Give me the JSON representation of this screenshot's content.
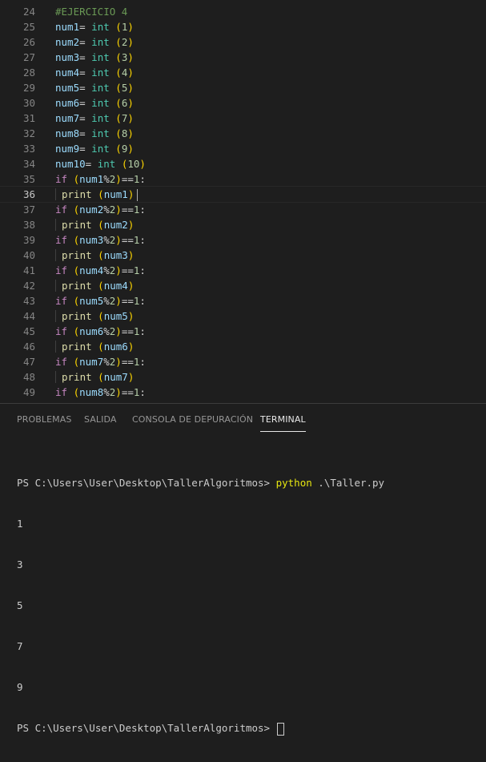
{
  "editor": {
    "current_line": 36,
    "lines": [
      {
        "n": "24",
        "tokens": [
          {
            "t": "#EJERCICIO 4",
            "c": "comment"
          }
        ]
      },
      {
        "n": "25",
        "tokens": [
          {
            "t": "num1",
            "c": "var"
          },
          {
            "t": "= ",
            "c": "plain"
          },
          {
            "t": "int",
            "c": "fn"
          },
          {
            "t": " ",
            "c": "plain"
          },
          {
            "t": "(",
            "c": "paren"
          },
          {
            "t": "1",
            "c": "num"
          },
          {
            "t": ")",
            "c": "paren"
          }
        ]
      },
      {
        "n": "26",
        "tokens": [
          {
            "t": "num2",
            "c": "var"
          },
          {
            "t": "= ",
            "c": "plain"
          },
          {
            "t": "int",
            "c": "fn"
          },
          {
            "t": " ",
            "c": "plain"
          },
          {
            "t": "(",
            "c": "paren"
          },
          {
            "t": "2",
            "c": "num"
          },
          {
            "t": ")",
            "c": "paren"
          }
        ]
      },
      {
        "n": "27",
        "tokens": [
          {
            "t": "num3",
            "c": "var"
          },
          {
            "t": "= ",
            "c": "plain"
          },
          {
            "t": "int",
            "c": "fn"
          },
          {
            "t": " ",
            "c": "plain"
          },
          {
            "t": "(",
            "c": "paren"
          },
          {
            "t": "3",
            "c": "num"
          },
          {
            "t": ")",
            "c": "paren"
          }
        ]
      },
      {
        "n": "28",
        "tokens": [
          {
            "t": "num4",
            "c": "var"
          },
          {
            "t": "= ",
            "c": "plain"
          },
          {
            "t": "int",
            "c": "fn"
          },
          {
            "t": " ",
            "c": "plain"
          },
          {
            "t": "(",
            "c": "paren"
          },
          {
            "t": "4",
            "c": "num"
          },
          {
            "t": ")",
            "c": "paren"
          }
        ]
      },
      {
        "n": "29",
        "tokens": [
          {
            "t": "num5",
            "c": "var"
          },
          {
            "t": "= ",
            "c": "plain"
          },
          {
            "t": "int",
            "c": "fn"
          },
          {
            "t": " ",
            "c": "plain"
          },
          {
            "t": "(",
            "c": "paren"
          },
          {
            "t": "5",
            "c": "num"
          },
          {
            "t": ")",
            "c": "paren"
          }
        ]
      },
      {
        "n": "30",
        "tokens": [
          {
            "t": "num6",
            "c": "var"
          },
          {
            "t": "= ",
            "c": "plain"
          },
          {
            "t": "int",
            "c": "fn"
          },
          {
            "t": " ",
            "c": "plain"
          },
          {
            "t": "(",
            "c": "paren"
          },
          {
            "t": "6",
            "c": "num"
          },
          {
            "t": ")",
            "c": "paren"
          }
        ]
      },
      {
        "n": "31",
        "tokens": [
          {
            "t": "num7",
            "c": "var"
          },
          {
            "t": "= ",
            "c": "plain"
          },
          {
            "t": "int",
            "c": "fn"
          },
          {
            "t": " ",
            "c": "plain"
          },
          {
            "t": "(",
            "c": "paren"
          },
          {
            "t": "7",
            "c": "num"
          },
          {
            "t": ")",
            "c": "paren"
          }
        ]
      },
      {
        "n": "32",
        "tokens": [
          {
            "t": "num8",
            "c": "var"
          },
          {
            "t": "= ",
            "c": "plain"
          },
          {
            "t": "int",
            "c": "fn"
          },
          {
            "t": " ",
            "c": "plain"
          },
          {
            "t": "(",
            "c": "paren"
          },
          {
            "t": "8",
            "c": "num"
          },
          {
            "t": ")",
            "c": "paren"
          }
        ]
      },
      {
        "n": "33",
        "tokens": [
          {
            "t": "num9",
            "c": "var"
          },
          {
            "t": "= ",
            "c": "plain"
          },
          {
            "t": "int",
            "c": "fn"
          },
          {
            "t": " ",
            "c": "plain"
          },
          {
            "t": "(",
            "c": "paren"
          },
          {
            "t": "9",
            "c": "num"
          },
          {
            "t": ")",
            "c": "paren"
          }
        ]
      },
      {
        "n": "34",
        "tokens": [
          {
            "t": "num10",
            "c": "var"
          },
          {
            "t": "= ",
            "c": "plain"
          },
          {
            "t": "int",
            "c": "fn"
          },
          {
            "t": " ",
            "c": "plain"
          },
          {
            "t": "(",
            "c": "paren"
          },
          {
            "t": "10",
            "c": "num"
          },
          {
            "t": ")",
            "c": "paren"
          }
        ]
      },
      {
        "n": "35",
        "tokens": [
          {
            "t": "if",
            "c": "kw"
          },
          {
            "t": " ",
            "c": "plain"
          },
          {
            "t": "(",
            "c": "paren"
          },
          {
            "t": "num1",
            "c": "var"
          },
          {
            "t": "%",
            "c": "plain"
          },
          {
            "t": "2",
            "c": "num"
          },
          {
            "t": ")",
            "c": "paren"
          },
          {
            "t": "==",
            "c": "plain"
          },
          {
            "t": "1",
            "c": "num"
          },
          {
            "t": ":",
            "c": "plain"
          }
        ]
      },
      {
        "n": "36",
        "indent": true,
        "cursor": true,
        "tokens": [
          {
            "t": "print",
            "c": "call"
          },
          {
            "t": " ",
            "c": "plain"
          },
          {
            "t": "(",
            "c": "paren"
          },
          {
            "t": "num1",
            "c": "var"
          },
          {
            "t": ")",
            "c": "paren"
          }
        ]
      },
      {
        "n": "37",
        "tokens": [
          {
            "t": "if",
            "c": "kw"
          },
          {
            "t": " ",
            "c": "plain"
          },
          {
            "t": "(",
            "c": "paren"
          },
          {
            "t": "num2",
            "c": "var"
          },
          {
            "t": "%",
            "c": "plain"
          },
          {
            "t": "2",
            "c": "num"
          },
          {
            "t": ")",
            "c": "paren"
          },
          {
            "t": "==",
            "c": "plain"
          },
          {
            "t": "1",
            "c": "num"
          },
          {
            "t": ":",
            "c": "plain"
          }
        ]
      },
      {
        "n": "38",
        "indent": true,
        "tokens": [
          {
            "t": "print",
            "c": "call"
          },
          {
            "t": " ",
            "c": "plain"
          },
          {
            "t": "(",
            "c": "paren"
          },
          {
            "t": "num2",
            "c": "var"
          },
          {
            "t": ")",
            "c": "paren"
          }
        ]
      },
      {
        "n": "39",
        "tokens": [
          {
            "t": "if",
            "c": "kw"
          },
          {
            "t": " ",
            "c": "plain"
          },
          {
            "t": "(",
            "c": "paren"
          },
          {
            "t": "num3",
            "c": "var"
          },
          {
            "t": "%",
            "c": "plain"
          },
          {
            "t": "2",
            "c": "num"
          },
          {
            "t": ")",
            "c": "paren"
          },
          {
            "t": "==",
            "c": "plain"
          },
          {
            "t": "1",
            "c": "num"
          },
          {
            "t": ":",
            "c": "plain"
          }
        ]
      },
      {
        "n": "40",
        "indent": true,
        "tokens": [
          {
            "t": "print",
            "c": "call"
          },
          {
            "t": " ",
            "c": "plain"
          },
          {
            "t": "(",
            "c": "paren"
          },
          {
            "t": "num3",
            "c": "var"
          },
          {
            "t": ")",
            "c": "paren"
          }
        ]
      },
      {
        "n": "41",
        "tokens": [
          {
            "t": "if",
            "c": "kw"
          },
          {
            "t": " ",
            "c": "plain"
          },
          {
            "t": "(",
            "c": "paren"
          },
          {
            "t": "num4",
            "c": "var"
          },
          {
            "t": "%",
            "c": "plain"
          },
          {
            "t": "2",
            "c": "num"
          },
          {
            "t": ")",
            "c": "paren"
          },
          {
            "t": "==",
            "c": "plain"
          },
          {
            "t": "1",
            "c": "num"
          },
          {
            "t": ":",
            "c": "plain"
          }
        ]
      },
      {
        "n": "42",
        "indent": true,
        "tokens": [
          {
            "t": "print",
            "c": "call"
          },
          {
            "t": " ",
            "c": "plain"
          },
          {
            "t": "(",
            "c": "paren"
          },
          {
            "t": "num4",
            "c": "var"
          },
          {
            "t": ")",
            "c": "paren"
          }
        ]
      },
      {
        "n": "43",
        "tokens": [
          {
            "t": "if",
            "c": "kw"
          },
          {
            "t": " ",
            "c": "plain"
          },
          {
            "t": "(",
            "c": "paren"
          },
          {
            "t": "num5",
            "c": "var"
          },
          {
            "t": "%",
            "c": "plain"
          },
          {
            "t": "2",
            "c": "num"
          },
          {
            "t": ")",
            "c": "paren"
          },
          {
            "t": "==",
            "c": "plain"
          },
          {
            "t": "1",
            "c": "num"
          },
          {
            "t": ":",
            "c": "plain"
          }
        ]
      },
      {
        "n": "44",
        "indent": true,
        "tokens": [
          {
            "t": "print",
            "c": "call"
          },
          {
            "t": " ",
            "c": "plain"
          },
          {
            "t": "(",
            "c": "paren"
          },
          {
            "t": "num5",
            "c": "var"
          },
          {
            "t": ")",
            "c": "paren"
          }
        ]
      },
      {
        "n": "45",
        "tokens": [
          {
            "t": "if",
            "c": "kw"
          },
          {
            "t": " ",
            "c": "plain"
          },
          {
            "t": "(",
            "c": "paren"
          },
          {
            "t": "num6",
            "c": "var"
          },
          {
            "t": "%",
            "c": "plain"
          },
          {
            "t": "2",
            "c": "num"
          },
          {
            "t": ")",
            "c": "paren"
          },
          {
            "t": "==",
            "c": "plain"
          },
          {
            "t": "1",
            "c": "num"
          },
          {
            "t": ":",
            "c": "plain"
          }
        ]
      },
      {
        "n": "46",
        "indent": true,
        "tokens": [
          {
            "t": "print",
            "c": "call"
          },
          {
            "t": " ",
            "c": "plain"
          },
          {
            "t": "(",
            "c": "paren"
          },
          {
            "t": "num6",
            "c": "var"
          },
          {
            "t": ")",
            "c": "paren"
          }
        ]
      },
      {
        "n": "47",
        "tokens": [
          {
            "t": "if",
            "c": "kw"
          },
          {
            "t": " ",
            "c": "plain"
          },
          {
            "t": "(",
            "c": "paren"
          },
          {
            "t": "num7",
            "c": "var"
          },
          {
            "t": "%",
            "c": "plain"
          },
          {
            "t": "2",
            "c": "num"
          },
          {
            "t": ")",
            "c": "paren"
          },
          {
            "t": "==",
            "c": "plain"
          },
          {
            "t": "1",
            "c": "num"
          },
          {
            "t": ":",
            "c": "plain"
          }
        ]
      },
      {
        "n": "48",
        "indent": true,
        "tokens": [
          {
            "t": "print",
            "c": "call"
          },
          {
            "t": " ",
            "c": "plain"
          },
          {
            "t": "(",
            "c": "paren"
          },
          {
            "t": "num7",
            "c": "var"
          },
          {
            "t": ")",
            "c": "paren"
          }
        ]
      },
      {
        "n": "49",
        "tokens": [
          {
            "t": "if",
            "c": "kw"
          },
          {
            "t": " ",
            "c": "plain"
          },
          {
            "t": "(",
            "c": "paren"
          },
          {
            "t": "num8",
            "c": "var"
          },
          {
            "t": "%",
            "c": "plain"
          },
          {
            "t": "2",
            "c": "num"
          },
          {
            "t": ")",
            "c": "paren"
          },
          {
            "t": "==",
            "c": "plain"
          },
          {
            "t": "1",
            "c": "num"
          },
          {
            "t": ":",
            "c": "plain"
          }
        ]
      }
    ]
  },
  "panel": {
    "tabs": [
      {
        "label": "PROBLEMAS",
        "active": false
      },
      {
        "label": "SALIDA",
        "active": false
      },
      {
        "label": "CONSOLA DE DEPURACIÓN",
        "active": false
      },
      {
        "label": "TERMINAL",
        "active": true
      }
    ],
    "terminal": {
      "prompt": "PS C:\\Users\\User\\Desktop\\TallerAlgoritmos> ",
      "command": "python",
      "args": " .\\Taller.py",
      "output": [
        "1",
        "3",
        "5",
        "7",
        "9"
      ],
      "final_prompt": "PS C:\\Users\\User\\Desktop\\TallerAlgoritmos> "
    }
  },
  "colors": {
    "background": "#1e1e1e",
    "keyword": "#c586c0",
    "variable": "#9cdcfe",
    "builtin": "#4ec9b0",
    "function": "#dcdcaa",
    "paren": "#ffd700",
    "number": "#b5cea8",
    "comment": "#6a9955",
    "terminal_command": "#e5e510"
  }
}
